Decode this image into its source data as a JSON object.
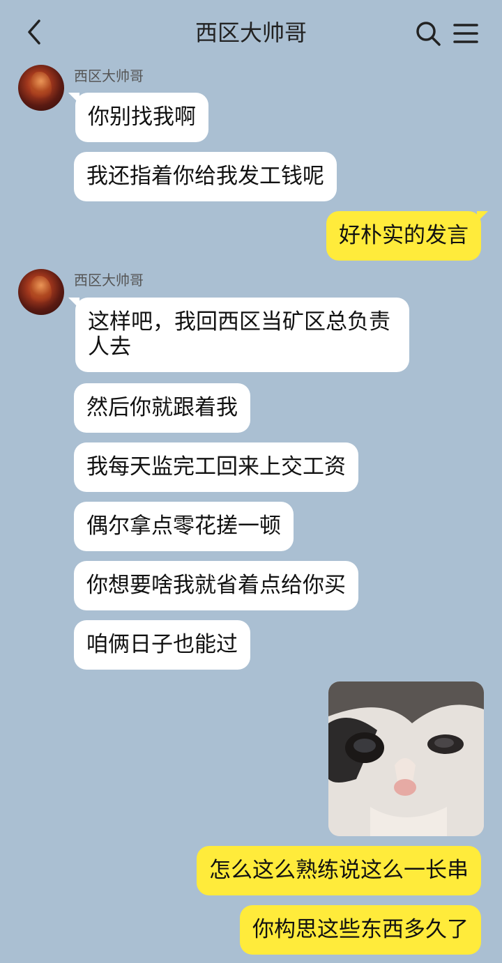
{
  "header": {
    "title": "西区大帅哥"
  },
  "messages": [
    {
      "sender": "西区大帅哥",
      "text": "你别找我啊"
    },
    {
      "text": "我还指着你给我发工钱呢"
    },
    {
      "mine": true,
      "text": "好朴实的发言"
    },
    {
      "sender": "西区大帅哥",
      "text": "这样吧，我回西区当矿区总负责人去"
    },
    {
      "text": "然后你就跟着我"
    },
    {
      "text": "我每天监完工回来上交工资"
    },
    {
      "text": "偶尔拿点零花搓一顿"
    },
    {
      "text": "你想要啥我就省着点给你买"
    },
    {
      "text": "咱俩日子也能过"
    },
    {
      "mine": true,
      "text": "怎么这么熟练说这么一长串"
    },
    {
      "mine": true,
      "text": "你构思这些东西多久了"
    }
  ],
  "colors": {
    "background": "#aabfd2",
    "my_bubble": "#ffeb3b",
    "their_bubble": "#ffffff"
  }
}
